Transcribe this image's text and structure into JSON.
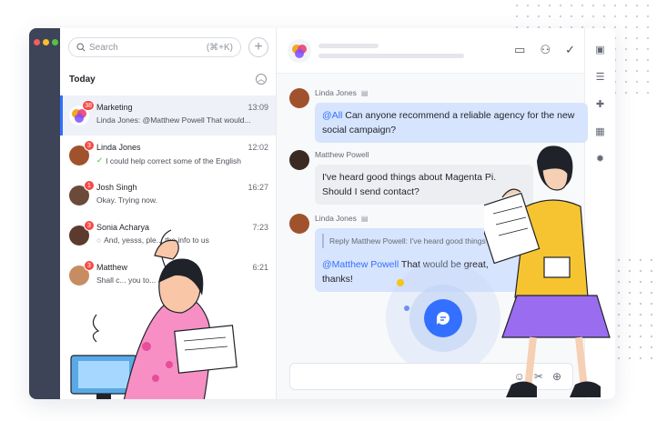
{
  "search": {
    "placeholder": "Search",
    "shortcut": "(⌘+K)"
  },
  "section": {
    "label": "Today"
  },
  "conversations": [
    {
      "name": "Marketing",
      "time": "13:09",
      "preview": "Linda Jones: @Matthew Powell That would...",
      "badge": "38"
    },
    {
      "name": "Linda Jones",
      "time": "12:02",
      "preview": "I could help correct some of the English",
      "badge": "3"
    },
    {
      "name": "Josh Singh",
      "time": "16:27",
      "preview": "Okay. Trying now.",
      "badge": "1"
    },
    {
      "name": "Sonia Acharya",
      "time": "7:23",
      "preview": "And, yesss, ple... the info to us",
      "badge": "3"
    },
    {
      "name": "Matthew",
      "time": "6:21",
      "preview": "Shall c... you to...",
      "badge": "3"
    }
  ],
  "messages": [
    {
      "sender": "Linda Jones",
      "mention": "@All",
      "text": " Can anyone recommend a reliable agency for the new social campaign?"
    },
    {
      "sender": "Matthew Powell",
      "text": "I've heard good things about Magenta Pi. Should I send contact?"
    },
    {
      "sender": "Linda Jones",
      "quote": "Reply Matthew Powell: I've heard good things about...",
      "mention": "@Matthew Powell",
      "text": " That would be great, thanks!"
    }
  ],
  "colors": {
    "accent": "#3370ff",
    "rail": "#3d4457",
    "bubble": "#d7e4fe",
    "badge": "#f54a45"
  },
  "icons": {
    "header": [
      "video-icon",
      "add-member-icon",
      "check-icon"
    ],
    "side": [
      "briefcase-icon",
      "search-list-icon",
      "pin-icon",
      "calendar-add-icon",
      "settings-icon"
    ],
    "input": [
      "emoji-icon",
      "scissors-icon",
      "plus-circle-icon"
    ]
  }
}
